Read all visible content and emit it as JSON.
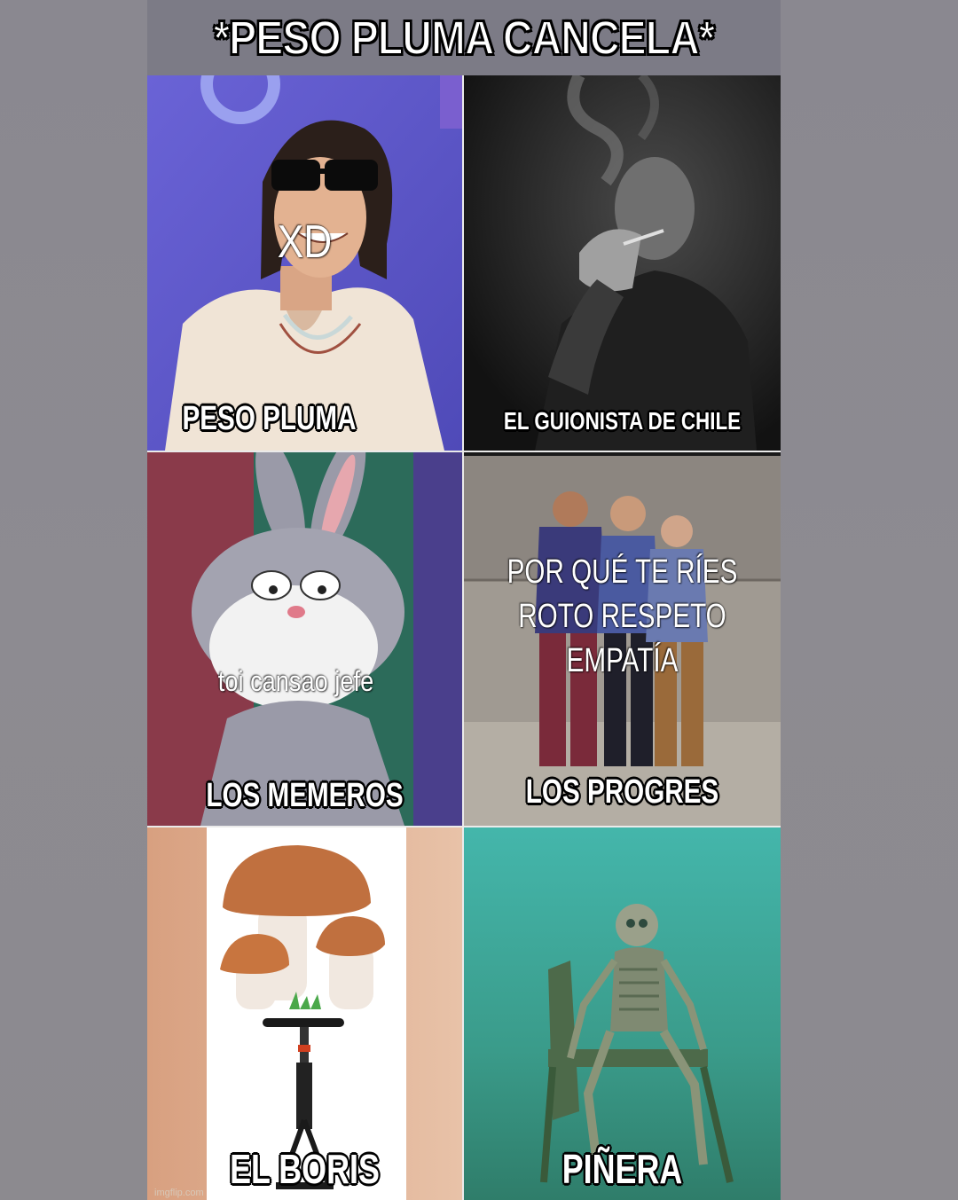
{
  "title": "*PESO PLUMA CANCELA*",
  "panels": {
    "peso_pluma": {
      "caption": "PESO PLUMA",
      "overlay": "XD"
    },
    "guionista": {
      "caption": "EL GUIONISTA DE CHILE"
    },
    "memeros": {
      "caption": "LOS MEMEROS",
      "overlay": "toi cansao jefe"
    },
    "progres": {
      "caption": "LOS PROGRES",
      "overlay_lines": [
        "POR QUÉ TE RÍES",
        "ROTO RESPETO",
        "EMPATÍA"
      ]
    },
    "boris": {
      "caption": "EL BORIS",
      "watermark": "imgflip.com"
    },
    "pinera": {
      "caption": "PIÑERA"
    }
  },
  "colors": {
    "background": "#8c8a8f",
    "title_bar": "#7c7b86",
    "purple_backdrop": "#5b55c8",
    "water": "#3fa99a"
  }
}
